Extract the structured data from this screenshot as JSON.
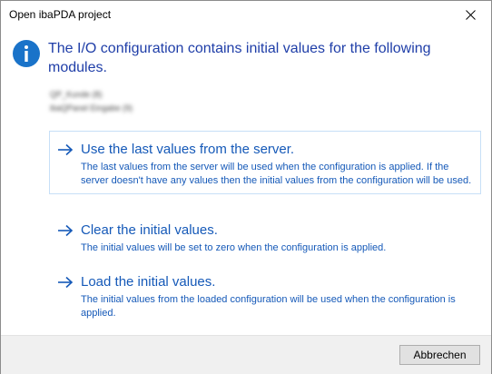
{
  "window": {
    "title": "Open ibaPDA project",
    "close_icon": "close-icon"
  },
  "message": {
    "icon": "info-icon",
    "heading": "The I/O configuration contains initial values for the following modules.",
    "modules": [
      "QP_Kunde (8)",
      "ibaQPanel Eingabe (9)"
    ]
  },
  "options": [
    {
      "title": "Use the last values from the server.",
      "description": "The last values from the server will be used when the configuration is applied. If the server doesn't have any values then the initial values from the configuration will be used."
    },
    {
      "title": "Clear the initial values.",
      "description": "The initial values will be set to zero when the configuration is applied."
    },
    {
      "title": "Load the initial values.",
      "description": "The initial values from the loaded configuration will be used when the configuration is applied."
    }
  ],
  "footer": {
    "cancel_label": "Abbrechen"
  },
  "colors": {
    "heading": "#1f3ea8",
    "link": "#1559b8",
    "info_icon": "#1a73c9"
  }
}
